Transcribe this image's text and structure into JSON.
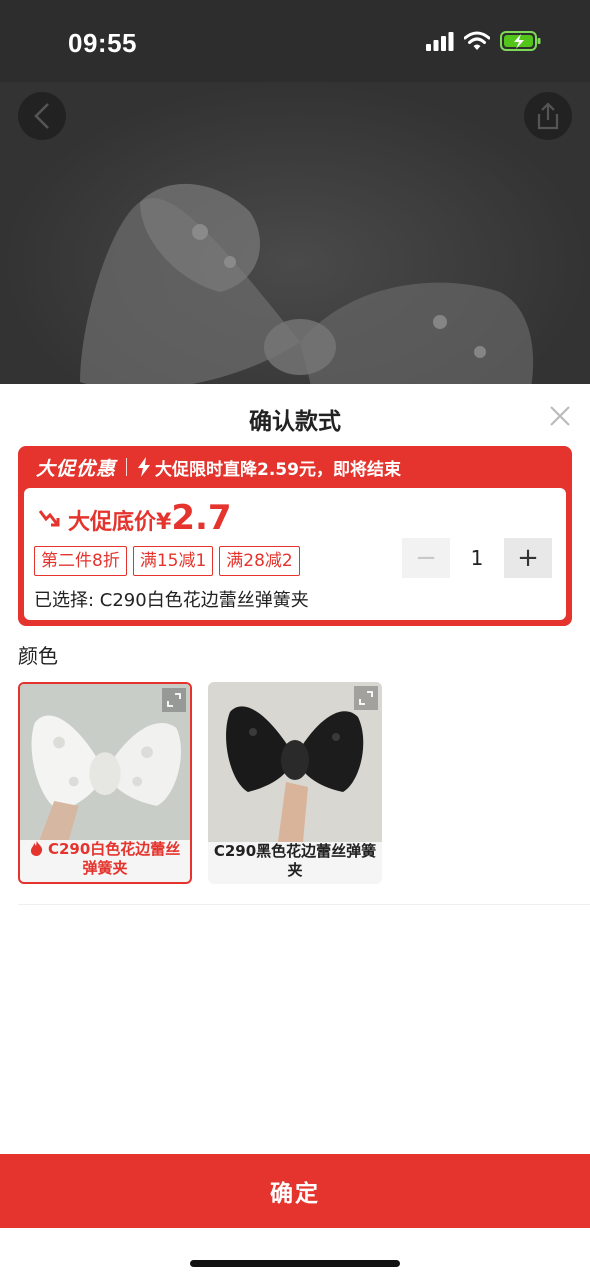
{
  "status_bar": {
    "time": "09:55"
  },
  "sheet": {
    "title": "确认款式",
    "promo": {
      "tag": "大促优惠",
      "message": "大促限时直降2.59元，即将结束",
      "price_label": "大促底价",
      "currency": "¥",
      "price": "2.7",
      "coupons": [
        "第二件8折",
        "满15减1",
        "满28减2"
      ],
      "selected": "已选择: C290白色花边蕾丝弹簧夹",
      "quantity": "1",
      "minus": "−",
      "plus": "+"
    },
    "color_label": "颜色",
    "options": [
      {
        "name": "C290白色花边蕾丝弹簧夹",
        "selected": true
      },
      {
        "name": "C290黑色花边蕾丝弹簧夹",
        "selected": false
      }
    ],
    "confirm_label": "确定"
  },
  "colors": {
    "accent": "#e4342d",
    "status_bar": "#2d2d2d"
  },
  "icons": [
    "back-icon",
    "share-icon",
    "close-icon",
    "trend-down-icon",
    "bolt-icon",
    "fire-icon",
    "expand-icon"
  ]
}
